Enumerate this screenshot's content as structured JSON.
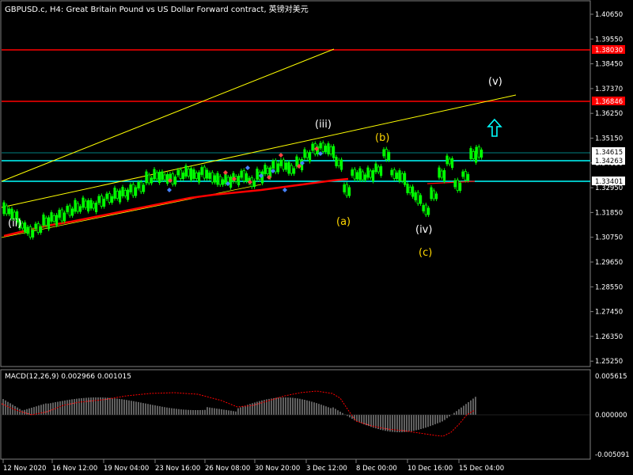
{
  "window": {
    "title": "GBPUSD.c, H4:  Great Britain Pound vs US Dollar Forward contract, 英镑对美元"
  },
  "price_axis": {
    "ticks": [
      "1.40650",
      "1.39550",
      "1.38450",
      "1.37370",
      "1.36250",
      "1.35150",
      "1.34050",
      "1.32950",
      "1.31850",
      "1.30750",
      "1.29650",
      "1.28550",
      "1.27450",
      "1.26350",
      "1.25250"
    ]
  },
  "price_tags": {
    "red_top": "1.38030",
    "red_mid": "1.36846",
    "current": "1.34615",
    "cyan_top": "1.34263",
    "cyan_bottom": "1.33401"
  },
  "macd": {
    "title": "MACD(12,26,9) 0.002966 0.001015",
    "ticks": [
      "0.005615",
      "0.000000",
      "-0.005091"
    ]
  },
  "time_axis": {
    "labels": [
      "12 Nov 2020",
      "16 Nov 12:00",
      "19 Nov 04:00",
      "23 Nov 16:00",
      "26 Nov 08:00",
      "30 Nov 20:00",
      "3 Dec 12:00",
      "8 Dec 00:00",
      "10 Dec 16:00",
      "15 Dec 04:00"
    ]
  },
  "wave_labels": {
    "ii": "(ii)",
    "iii": "(iii)",
    "iv": "(iv)",
    "v": "(v)",
    "a": "(a)",
    "b": "(b)",
    "c": "(c)"
  },
  "colors": {
    "background": "#000000",
    "candle": "#00ff00",
    "ma": "#ff0000",
    "level_red": "#ff0000",
    "level_cyan": "#00ffff",
    "trendline": "#ffff00",
    "macd_hist": "#c0c0c0",
    "macd_signal": "#ff0000",
    "wave_white": "#ffffff",
    "wave_yellow": "#ffd700",
    "arrow": "#00ffff"
  },
  "icons": {
    "up_arrow": "up-arrow-icon"
  }
}
